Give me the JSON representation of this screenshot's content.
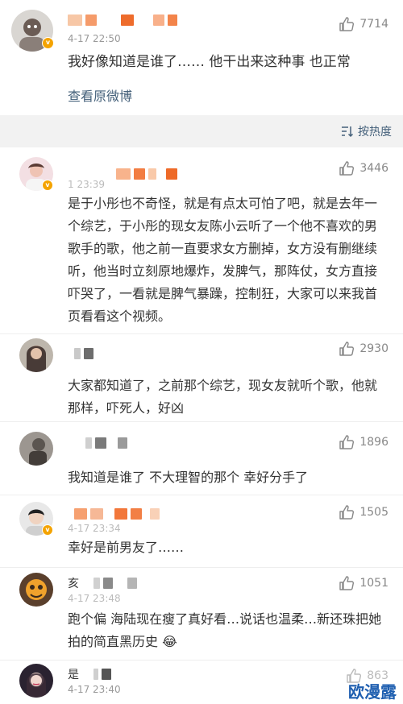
{
  "original_post": {
    "time": "4-17 22:50",
    "likes": "7714",
    "text": "我好像知道是谁了…… 他干出来这种事 也正常",
    "view_original": "查看原微博"
  },
  "sort": {
    "label": "按热度",
    "icon": "sort-icon"
  },
  "comments": [
    {
      "time": "1 23:39",
      "likes": "3446",
      "text": "是于小彤也不奇怪，就是有点太可怕了吧，就是去年一个综艺，于小彤的现女友陈小云听了一个他不喜欢的男歌手的歌，他之前一直要求女方删掉，女方没有删继续听，他当时立刻原地爆炸，发脾气，那阵仗，女方直接吓哭了，一看就是脾气暴躁，控制狂，大家可以来我首页看看这个视频。"
    },
    {
      "likes": "2930",
      "text": "大家都知道了，之前那个综艺，现女友就听个歌，他就那样，吓死人，好凶"
    },
    {
      "likes": "1896",
      "text": "我知道是谁了 不大理智的那个 幸好分手了"
    },
    {
      "time": "4-17 23:34",
      "likes": "1505",
      "text": "幸好是前男友了……"
    },
    {
      "name": "亥",
      "time": "4-17 23:48",
      "likes": "1051",
      "text": "跑个偏  海陆现在瘦了真好看…说话也温柔…新还珠把她拍的简直黑历史",
      "emoji": "😂"
    },
    {
      "name": "是",
      "time": "4-17 23:40",
      "likes": "863"
    }
  ],
  "watermark": "欧漫露",
  "colors": {
    "link": "#44607a",
    "meta": "#999999",
    "badge": "#f4a300",
    "watermark": "#1f5fb0"
  }
}
